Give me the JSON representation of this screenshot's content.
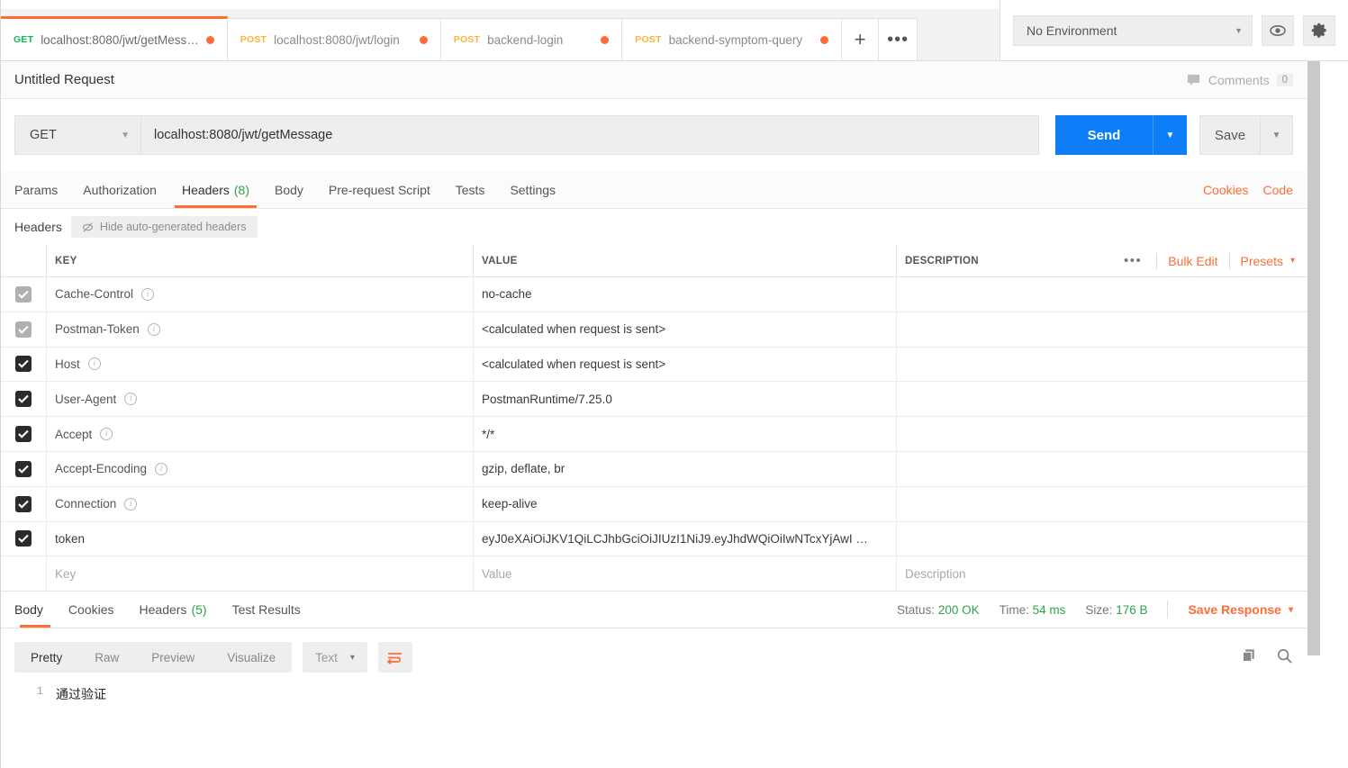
{
  "tabs": [
    {
      "method": "GET",
      "label": "localhost:8080/jwt/getMess…",
      "unsaved": true,
      "active": true
    },
    {
      "method": "POST",
      "label": "localhost:8080/jwt/login",
      "unsaved": true,
      "active": false
    },
    {
      "method": "POST",
      "label": "backend-login",
      "unsaved": true,
      "active": false
    },
    {
      "method": "POST",
      "label": "backend-symptom-query",
      "unsaved": true,
      "active": false
    }
  ],
  "tabstrip": {
    "new_tab": "+",
    "more_tabs": "•••"
  },
  "environment": {
    "selected": "No Environment",
    "caret": "▾",
    "eye_icon": "eye-icon",
    "gear_icon": "gear-icon"
  },
  "request": {
    "title": "Untitled Request",
    "comments_label": "Comments",
    "comments_count": "0",
    "method": "GET",
    "url": "localhost:8080/jwt/getMessage",
    "send_label": "Send",
    "save_label": "Save",
    "caret": "▾"
  },
  "subtabs": [
    {
      "label": "Params",
      "count": "",
      "active": false
    },
    {
      "label": "Authorization",
      "count": "",
      "active": false
    },
    {
      "label": "Headers",
      "count": "(8)",
      "active": true
    },
    {
      "label": "Body",
      "count": "",
      "active": false
    },
    {
      "label": "Pre-request Script",
      "count": "",
      "active": false
    },
    {
      "label": "Tests",
      "count": "",
      "active": false
    },
    {
      "label": "Settings",
      "count": "",
      "active": false
    }
  ],
  "subtabs_right": {
    "cookies": "Cookies",
    "code": "Code"
  },
  "headers_panel": {
    "title": "Headers",
    "hide_auto_label": "Hide auto-generated headers",
    "columns": {
      "key": "KEY",
      "value": "VALUE",
      "description": "DESCRIPTION"
    },
    "actions": {
      "more": "•••",
      "bulk_edit": "Bulk Edit",
      "presets": "Presets",
      "presets_caret": "▾"
    },
    "rows": [
      {
        "checked": true,
        "disabled": true,
        "key": "Cache-Control",
        "info": true,
        "value": "no-cache",
        "description": ""
      },
      {
        "checked": true,
        "disabled": true,
        "key": "Postman-Token",
        "info": true,
        "value": "<calculated when request is sent>",
        "description": ""
      },
      {
        "checked": true,
        "disabled": false,
        "key": "Host",
        "info": true,
        "value": "<calculated when request is sent>",
        "description": ""
      },
      {
        "checked": true,
        "disabled": false,
        "key": "User-Agent",
        "info": true,
        "value": "PostmanRuntime/7.25.0",
        "description": ""
      },
      {
        "checked": true,
        "disabled": false,
        "key": "Accept",
        "info": true,
        "value": "*/*",
        "description": ""
      },
      {
        "checked": true,
        "disabled": false,
        "key": "Accept-Encoding",
        "info": true,
        "value": "gzip, deflate, br",
        "description": ""
      },
      {
        "checked": true,
        "disabled": false,
        "key": "Connection",
        "info": true,
        "value": "keep-alive",
        "description": ""
      },
      {
        "checked": true,
        "disabled": false,
        "key": "token",
        "info": false,
        "value": "eyJ0eXAiOiJKV1QiLCJhbGciOiJIUzI1NiJ9.eyJhdWQiOiIwNTcxYjAwI …",
        "description": ""
      }
    ],
    "placeholder_row": {
      "key": "Key",
      "value": "Value",
      "description": "Description"
    }
  },
  "response": {
    "tabs": [
      {
        "label": "Body",
        "count": "",
        "active": true
      },
      {
        "label": "Cookies",
        "count": "",
        "active": false
      },
      {
        "label": "Headers",
        "count": "(5)",
        "active": false
      },
      {
        "label": "Test Results",
        "count": "",
        "active": false
      }
    ],
    "status_label": "Status:",
    "status_value": "200 OK",
    "time_label": "Time:",
    "time_value": "54 ms",
    "size_label": "Size:",
    "size_value": "176 B",
    "save_response": "Save Response",
    "save_response_caret": "▾",
    "view_modes": [
      {
        "label": "Pretty",
        "active": true
      },
      {
        "label": "Raw",
        "active": false
      },
      {
        "label": "Preview",
        "active": false
      },
      {
        "label": "Visualize",
        "active": false
      }
    ],
    "format": "Text",
    "format_caret": "▾",
    "wrap_icon": "wrap-lines-icon",
    "copy_icon": "copy-icon",
    "search_icon": "search-icon",
    "body_lines": [
      {
        "no": "1",
        "text": "通过验证"
      }
    ]
  },
  "colors": {
    "accent_orange": "#ff6c37",
    "send_blue": "#0d7ef7",
    "success_green": "#30a14e",
    "get_green": "#0cbb52",
    "post_yellow": "#ffb13b"
  }
}
